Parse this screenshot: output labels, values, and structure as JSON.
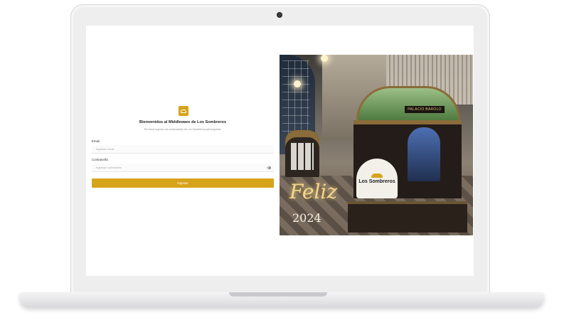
{
  "login": {
    "title": "Bienvenidos al Middleware de Los Sombreros",
    "subtitle": "Por favor ingrese sus credenciales de Los Sombreros para ingresar.",
    "email_label": "Email",
    "email_placeholder": "Ingresar email",
    "password_label": "Contraseña",
    "password_placeholder": "Ingresar contraseña",
    "submit_label": "Ingresar"
  },
  "hero": {
    "brand": "Los Sombreros",
    "plaque": "PALACIO BAROLO",
    "greeting": "Feliz",
    "year": "2024"
  },
  "colors": {
    "accent": "#d7a31a"
  },
  "icons": {
    "logo": "hat-icon",
    "password_toggle": "eye-icon"
  }
}
